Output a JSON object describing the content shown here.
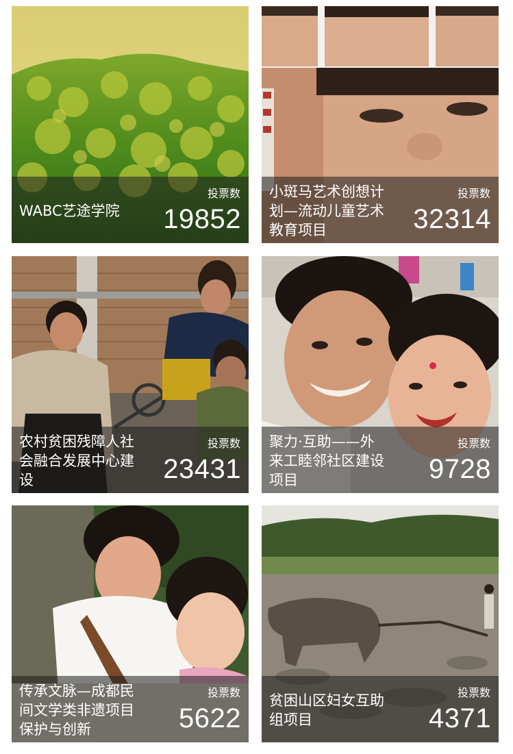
{
  "vote_label": "投票数",
  "projects": [
    {
      "title": "WABC艺途学院",
      "votes": "19852"
    },
    {
      "title": "小斑马艺术创想计划—流动儿童艺术教育项目",
      "votes": "32314"
    },
    {
      "title": "农村贫困残障人社会融合发展中心建设",
      "votes": "23431"
    },
    {
      "title": "聚力·互助——外来工睦邻社区建设项目",
      "votes": "9728"
    },
    {
      "title": "传承文脉—成都民间文学类非遗项目保护与创新",
      "votes": "5622"
    },
    {
      "title": "贫困山区妇女互助组项目",
      "votes": "4371"
    }
  ]
}
